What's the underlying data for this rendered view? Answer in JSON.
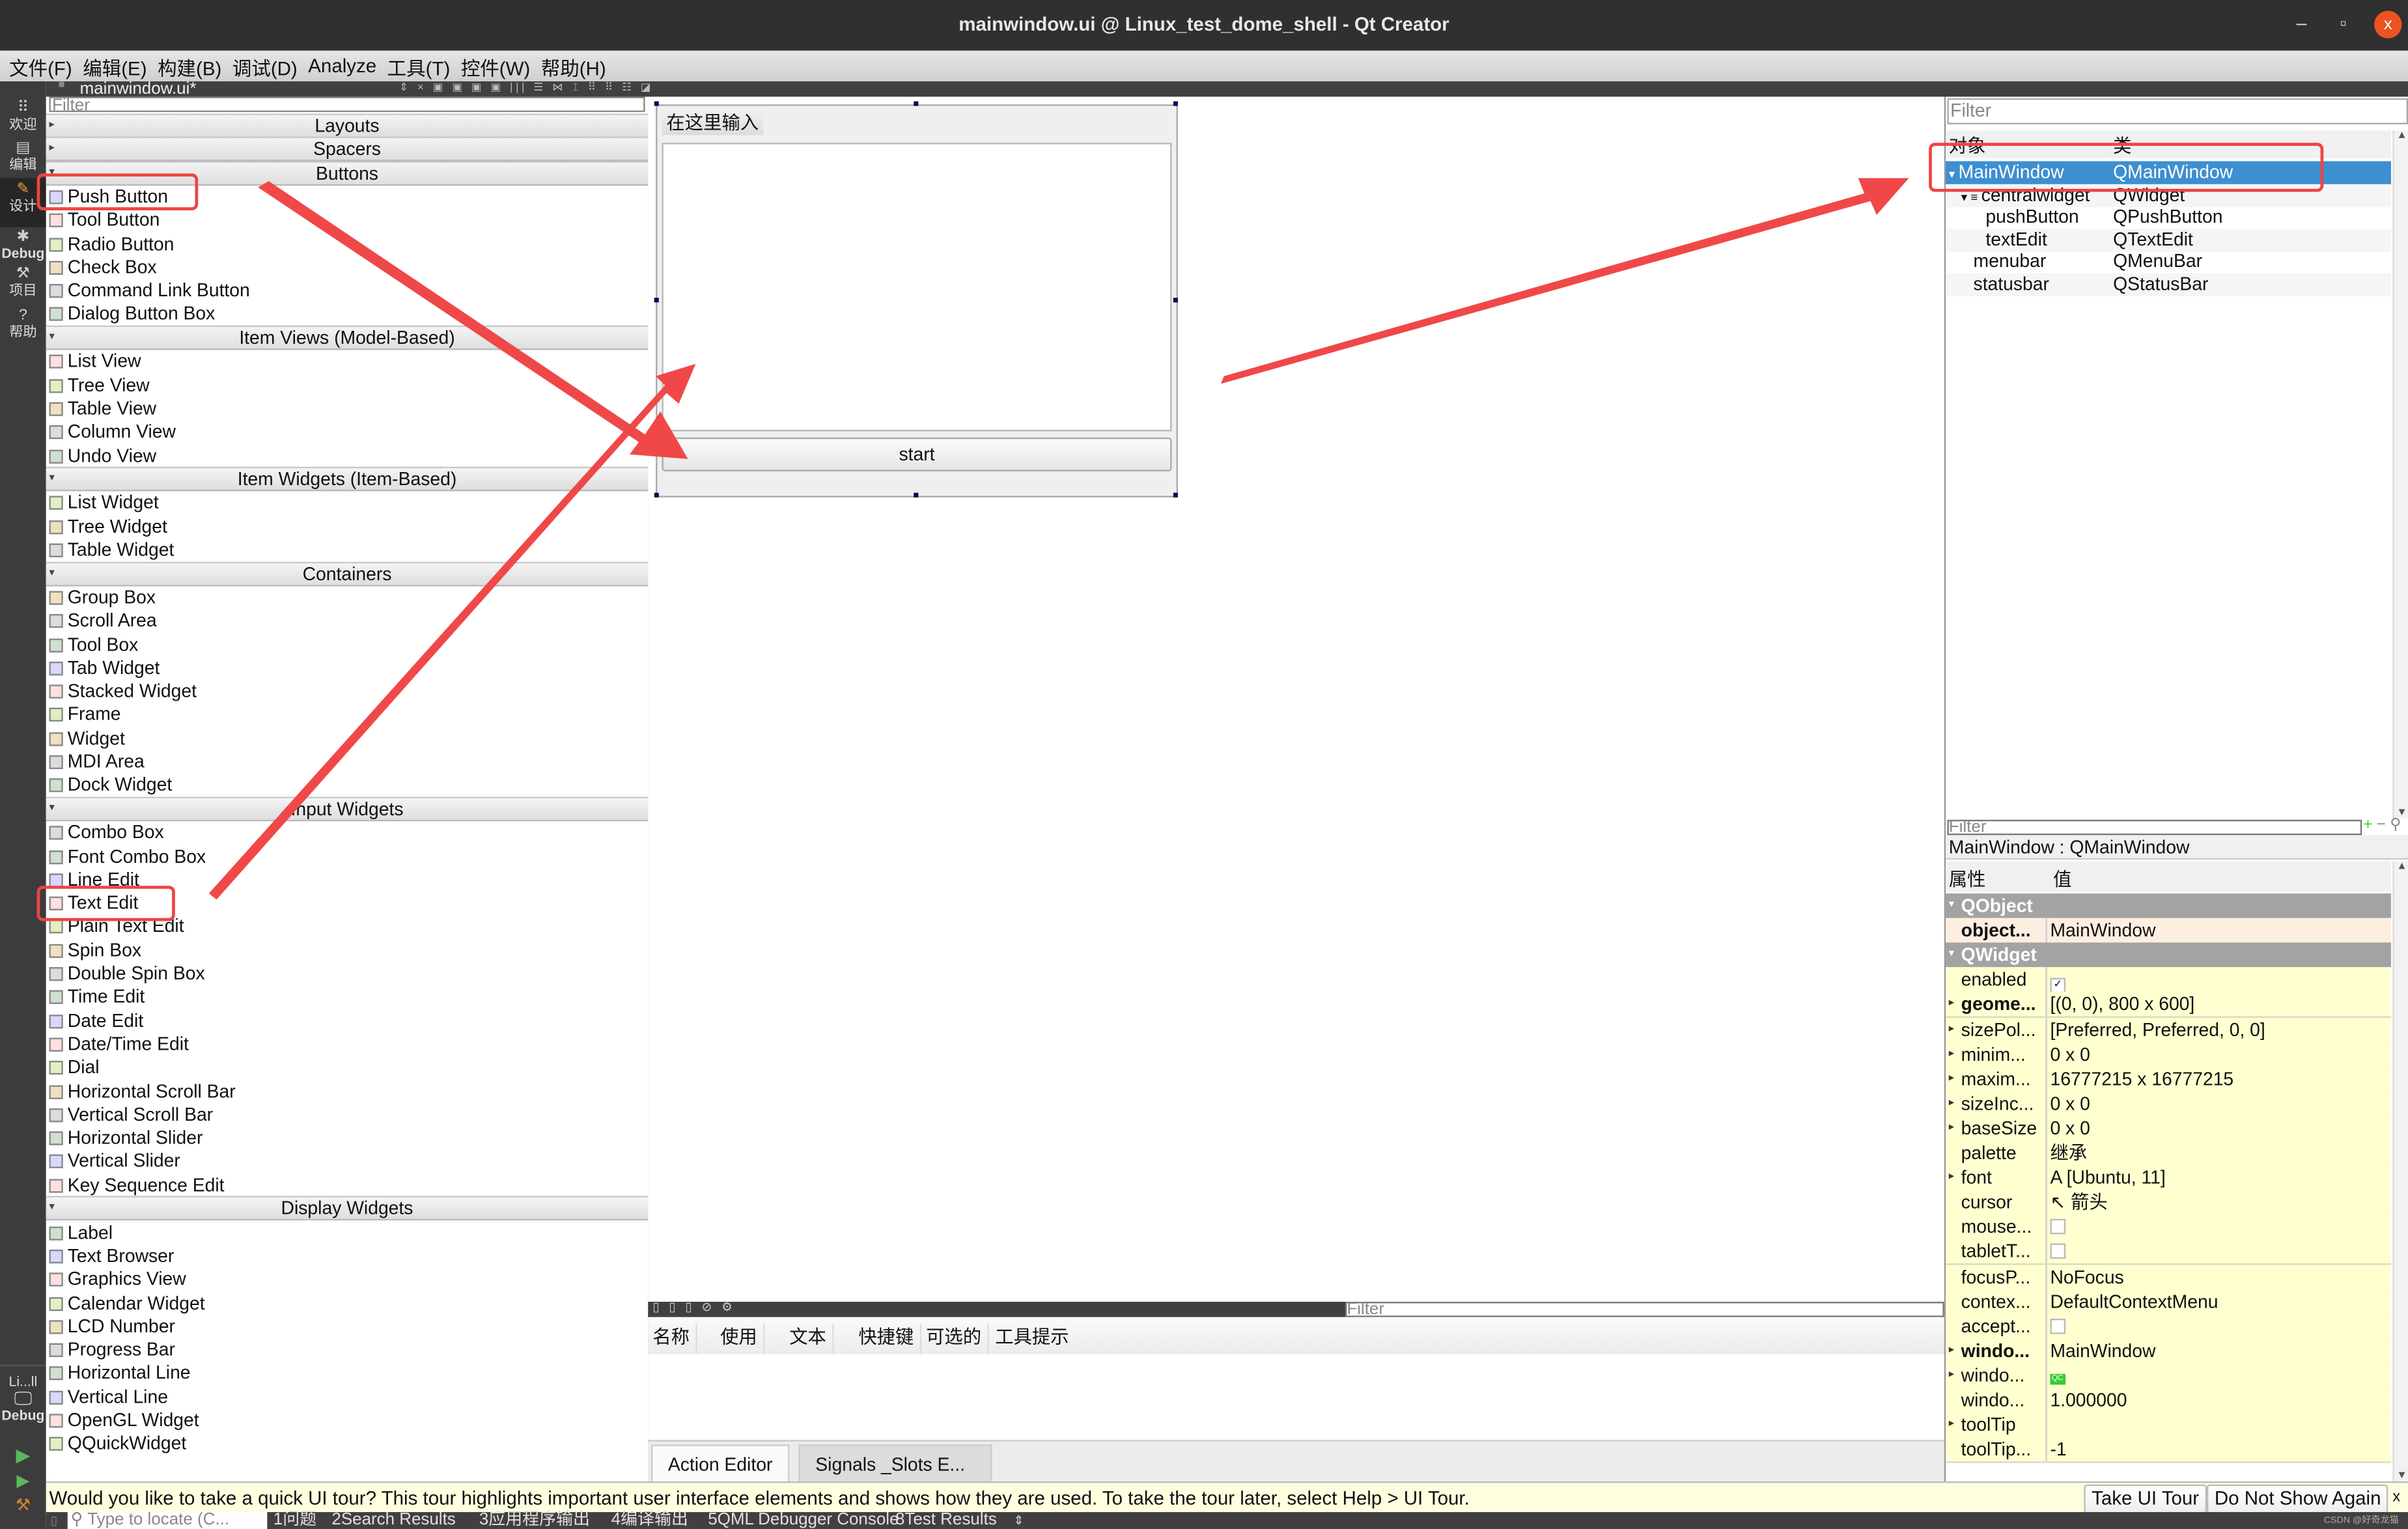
{
  "window": {
    "title": "mainwindow.ui @ Linux_test_dome_shell - Qt Creator",
    "controls": {
      "minimize": "–",
      "maximize": "▫",
      "close": "x"
    }
  },
  "menubar": [
    "文件(F)",
    "编辑(E)",
    "构建(B)",
    "调试(D)",
    "Analyze",
    "工具(T)",
    "控件(W)",
    "帮助(H)"
  ],
  "modebar": {
    "items": [
      {
        "label": "欢迎",
        "icon": "grid-icon"
      },
      {
        "label": "编辑",
        "icon": "document-icon"
      },
      {
        "label": "设计",
        "icon": "pencil-icon",
        "active": true
      },
      {
        "label": "Debug",
        "icon": "bug-icon"
      },
      {
        "label": "项目",
        "icon": "wrench-icon"
      },
      {
        "label": "帮助",
        "icon": "help-icon"
      }
    ],
    "kit_label": "Li...ll",
    "kit_mode": "Debug",
    "run_icons": [
      "run-icon",
      "debug-run-icon",
      "build-icon"
    ]
  },
  "editor": {
    "file_tab": "mainwindow.ui*",
    "lock_icon": "unlock-icon"
  },
  "widget_box": {
    "filter_placeholder": "Filter",
    "categories": [
      {
        "name": "Layouts",
        "expanded": false,
        "items": []
      },
      {
        "name": "Spacers",
        "expanded": false,
        "items": []
      },
      {
        "name": "Buttons",
        "expanded": true,
        "items": [
          "Push Button",
          "Tool Button",
          "Radio Button",
          "Check Box",
          "Command Link Button",
          "Dialog Button Box"
        ]
      },
      {
        "name": "Item Views (Model-Based)",
        "expanded": true,
        "items": [
          "List View",
          "Tree View",
          "Table View",
          "Column View",
          "Undo View"
        ]
      },
      {
        "name": "Item Widgets (Item-Based)",
        "expanded": true,
        "items": [
          "List Widget",
          "Tree Widget",
          "Table Widget"
        ]
      },
      {
        "name": "Containers",
        "expanded": true,
        "items": [
          "Group Box",
          "Scroll Area",
          "Tool Box",
          "Tab Widget",
          "Stacked Widget",
          "Frame",
          "Widget",
          "MDI Area",
          "Dock Widget"
        ]
      },
      {
        "name": "Input Widgets",
        "expanded": true,
        "items": [
          "Combo Box",
          "Font Combo Box",
          "Line Edit",
          "Text Edit",
          "Plain Text Edit",
          "Spin Box",
          "Double Spin Box",
          "Time Edit",
          "Date Edit",
          "Date/Time Edit",
          "Dial",
          "Horizontal Scroll Bar",
          "Vertical Scroll Bar",
          "Horizontal Slider",
          "Vertical Slider",
          "Key Sequence Edit"
        ]
      },
      {
        "name": "Display Widgets",
        "expanded": true,
        "items": [
          "Label",
          "Text Browser",
          "Graphics View",
          "Calendar Widget",
          "LCD Number",
          "Progress Bar",
          "Horizontal Line",
          "Vertical Line",
          "OpenGL Widget",
          "QQuickWidget"
        ]
      }
    ]
  },
  "form": {
    "menu_placeholder": "在这里输入",
    "button_text": "start"
  },
  "action_editor": {
    "filter_placeholder": "Filter",
    "columns": [
      "名称",
      "使用",
      "文本",
      "快捷键",
      "可选的",
      "工具提示"
    ],
    "tabs": [
      "Action Editor",
      "Signals _Slots E..."
    ]
  },
  "object_inspector": {
    "filter_placeholder": "Filter",
    "columns": [
      "对象",
      "类"
    ],
    "rows": [
      {
        "object": "MainWindow",
        "class": "QMainWindow",
        "level": 0,
        "selected": true
      },
      {
        "object": "centralwidget",
        "class": "QWidget",
        "level": 1
      },
      {
        "object": "pushButton",
        "class": "QPushButton",
        "level": 2
      },
      {
        "object": "textEdit",
        "class": "QTextEdit",
        "level": 2
      },
      {
        "object": "menubar",
        "class": "QMenuBar",
        "level": 1
      },
      {
        "object": "statusbar",
        "class": "QStatusBar",
        "level": 1
      }
    ]
  },
  "property_editor": {
    "filter_placeholder": "Filter",
    "class_label": "MainWindow : QMainWindow",
    "columns": [
      "属性",
      "值"
    ],
    "rows": [
      {
        "type": "group",
        "name": "QObject"
      },
      {
        "name": "object...",
        "value": "MainWindow",
        "bold": true,
        "kind": "obj"
      },
      {
        "type": "group",
        "name": "QWidget"
      },
      {
        "name": "enabled",
        "value": "✓",
        "check": true
      },
      {
        "name": "geome...",
        "value": "[(0, 0), 800 x 600]",
        "bold": true,
        "expand": true
      },
      {
        "name": "sizePol...",
        "value": "[Preferred, Preferred, 0, 0]",
        "expand": true
      },
      {
        "name": "minim...",
        "value": "0 x 0",
        "expand": true
      },
      {
        "name": "maxim...",
        "value": "16777215 x 16777215",
        "expand": true
      },
      {
        "name": "sizeInc...",
        "value": "0 x 0",
        "expand": true
      },
      {
        "name": "baseSize",
        "value": "0 x 0",
        "expand": true
      },
      {
        "name": "palette",
        "value": "继承"
      },
      {
        "name": "font",
        "value": "A [Ubuntu, 11]",
        "expand": true
      },
      {
        "name": "cursor",
        "value": "↖ 箭头"
      },
      {
        "name": "mouse...",
        "value": "",
        "check": true
      },
      {
        "name": "tabletT...",
        "value": "",
        "check": true
      },
      {
        "name": "focusP...",
        "value": "NoFocus"
      },
      {
        "name": "contex...",
        "value": "DefaultContextMenu"
      },
      {
        "name": "accept...",
        "value": "",
        "check": true
      },
      {
        "name": "windo...",
        "value": "MainWindow",
        "bold": true,
        "expand": true
      },
      {
        "name": "windo...",
        "value": "QC",
        "expand": true,
        "icon": true
      },
      {
        "name": "windo...",
        "value": "1.000000"
      },
      {
        "name": "toolTip",
        "value": "",
        "expand": true
      },
      {
        "name": "toolTip...",
        "value": "-1"
      }
    ]
  },
  "notice": {
    "text": "Would you like to take a quick UI tour? This tour highlights important user interface elements and shows how they are used. To take the tour later, select Help > UI Tour.",
    "take_tour": "Take UI Tour",
    "do_not_show": "Do Not Show Again",
    "close": "x"
  },
  "statusbar": {
    "locate_placeholder": "Type to locate (C...",
    "output_tabs": [
      "1问题",
      "2Search Results",
      "3应用程序输出",
      "4编译输出",
      "5QML Debugger Console",
      "8Test Results"
    ],
    "watermark": "CSDN @好奇龙猫"
  },
  "annotation_color": "#ee4444"
}
